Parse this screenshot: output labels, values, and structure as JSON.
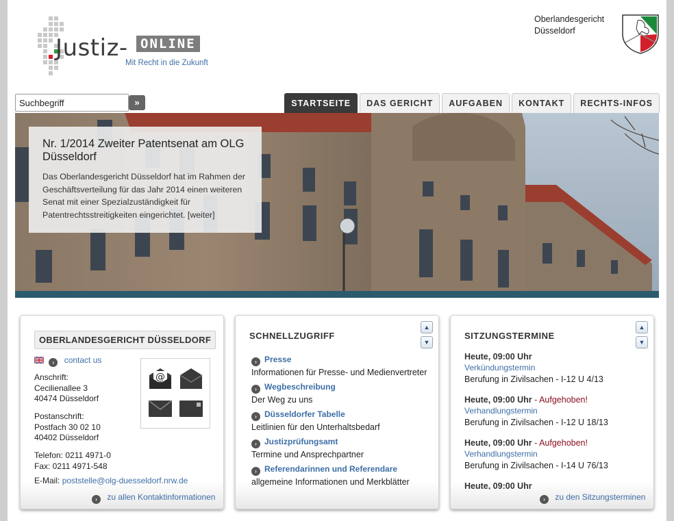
{
  "header": {
    "logo_title": "Justiz-",
    "logo_suffix": "ONLINE",
    "logo_claim": "Mit Recht in die Zukunft",
    "court_line1": "Oberlandesgericht",
    "court_line2": "Düsseldorf"
  },
  "search": {
    "placeholder": "Suchbegriff",
    "value": "Suchbegriff",
    "button": "»"
  },
  "nav": {
    "tabs": [
      {
        "label": "STARTSEITE",
        "active": true
      },
      {
        "label": "DAS GERICHT"
      },
      {
        "label": "AUFGABEN"
      },
      {
        "label": "KONTAKT"
      },
      {
        "label": "RECHTS-INFOS"
      }
    ]
  },
  "teaser": {
    "title": "Nr. 1/2014 Zweiter Patentsenat am OLG Düsseldorf",
    "text": "Das Oberlandesgericht Düsseldorf hat im Rahmen der Geschäftsverteilung für das Jahr 2014 einen weiteren Senat mit einer Spezialzuständigkeit für Patentrechtsstreitigkeiten eingerichtet.",
    "more": "[weiter]"
  },
  "contact_box": {
    "heading": "OBERLANDESGERICHT DÜSSELDORF",
    "contact_us": "contact us",
    "address_label": "Anschrift:",
    "address_street": "Cecilienallee 3",
    "address_city": "40474 Düsseldorf",
    "postal_label": "Postanschrift:",
    "postal_box": "Postfach 30 02 10",
    "postal_city": "40402 Düsseldorf",
    "phone": "Telefon: 0211 4971-0",
    "fax": "Fax: 0211 4971-548",
    "email_label": "E-Mail:",
    "email": "poststelle@olg-duesseldorf.nrw.de",
    "all_contacts": "zu allen Kontaktinformationen"
  },
  "quick_box": {
    "heading": "SCHNELLZUGRIFF",
    "items": [
      {
        "label": "Presse",
        "desc": "Informationen für Presse- und Medienvertreter"
      },
      {
        "label": "Wegbeschreibung",
        "desc": "Der Weg zu uns"
      },
      {
        "label": "Düsseldorfer Tabelle",
        "desc": "Leitlinien für den Unterhaltsbedarf"
      },
      {
        "label": "Justizprüfungsamt",
        "desc": "Termine und Ansprechpartner"
      },
      {
        "label": "Referendarinnen und Referendare",
        "desc": "allgemeine Informationen und Merkblätter"
      }
    ]
  },
  "terms_box": {
    "heading": "SITZUNGSTERMINE",
    "items": [
      {
        "time": "Heute, 09:00 Uhr",
        "cancel": "",
        "type": "Verkündungstermin",
        "desc": "Berufung in Zivilsachen - I-12 U 4/13"
      },
      {
        "time": "Heute, 09:00 Uhr",
        "cancel": " - Aufgehoben!",
        "type": "Verhandlungstermin",
        "desc": "Berufung in Zivilsachen - I-12 U 18/13"
      },
      {
        "time": "Heute, 09:00 Uhr",
        "cancel": " - Aufgehoben!",
        "type": "Verhandlungstermin",
        "desc": "Berufung in Zivilsachen - I-14 U 76/13"
      },
      {
        "time": "Heute, 09:00 Uhr",
        "cancel": "",
        "type": "",
        "desc": ""
      }
    ],
    "all_terms": "zu den Sitzungsterminen"
  },
  "colors": {
    "link": "#3d6ea6",
    "nav_active": "#3a3a3a",
    "hero_bar": "#2c5b6e",
    "cancel": "#8a1020"
  }
}
